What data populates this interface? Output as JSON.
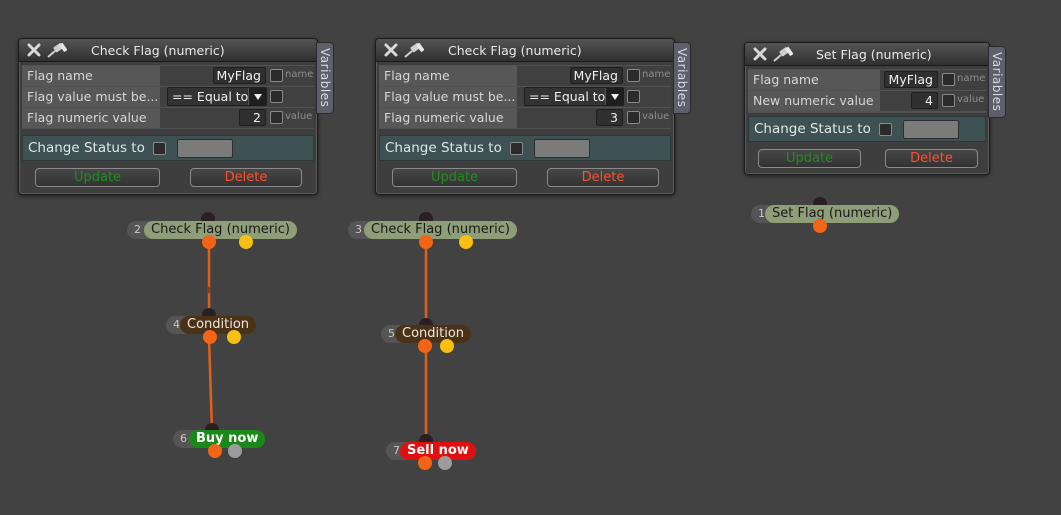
{
  "panels": [
    {
      "title": "Check Flag (numeric)",
      "variables_tab": "Variables",
      "flag_name": {
        "label": "Flag name",
        "value": "MyFlag",
        "hint": "name"
      },
      "flag_value_must_be": {
        "label": "Flag value must be...",
        "value": "== Equal to"
      },
      "numeric": {
        "label": "Flag numeric value",
        "value": "2",
        "hint": "value"
      },
      "change_status": {
        "label": "Change Status to"
      },
      "update_label": "Update",
      "delete_label": "Delete"
    },
    {
      "title": "Check Flag (numeric)",
      "variables_tab": "Variables",
      "flag_name": {
        "label": "Flag name",
        "value": "MyFlag",
        "hint": "name"
      },
      "flag_value_must_be": {
        "label": "Flag value must be...",
        "value": "== Equal to"
      },
      "numeric": {
        "label": "Flag numeric value",
        "value": "3",
        "hint": "value"
      },
      "change_status": {
        "label": "Change Status to"
      },
      "update_label": "Update",
      "delete_label": "Delete"
    },
    {
      "title": "Set Flag (numeric)",
      "variables_tab": "Variables",
      "flag_name": {
        "label": "Flag name",
        "value": "MyFlag",
        "hint": "name"
      },
      "numeric": {
        "label": "New numeric value",
        "value": "4",
        "hint": "value"
      },
      "change_status": {
        "label": "Change Status to"
      },
      "update_label": "Update",
      "delete_label": "Delete"
    }
  ],
  "nodes": [
    {
      "index": "2",
      "label": "Check Flag (numeric)"
    },
    {
      "index": "4",
      "label": "Condition"
    },
    {
      "index": "6",
      "label": "Buy now"
    },
    {
      "index": "3",
      "label": "Check Flag (numeric)"
    },
    {
      "index": "5",
      "label": "Condition"
    },
    {
      "index": "7",
      "label": "Sell now"
    },
    {
      "index": "1",
      "label": "Set Flag (numeric)"
    }
  ],
  "colors": {
    "background": "#424242",
    "check_node": "#8d9e78",
    "condition_node": "#4a3218",
    "buy_node": "#198a19",
    "sell_node": "#e01010",
    "output_dot": "#f26516",
    "false_dot": "#f7c012",
    "wire": "#e0601a"
  },
  "icons": [
    "close-icon",
    "pin-icon",
    "dropdown-arrow-icon"
  ]
}
